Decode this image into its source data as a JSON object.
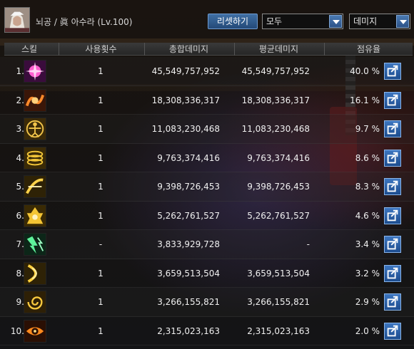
{
  "character": {
    "name": "뇌공 / 眞 아수라 (Lv.100)"
  },
  "toolbar": {
    "reset_label": "리셋하기",
    "filter_value": "모두",
    "sort_value": "데미지"
  },
  "table": {
    "headers": {
      "skill": "스킬",
      "uses": "사용횟수",
      "total": "총합데미지",
      "avg": "평균데미지",
      "share": "점유율"
    },
    "rows": [
      {
        "rank": "1.",
        "uses": "1",
        "total": "45,549,757,952",
        "avg": "45,549,757,952",
        "share": "40.0 %",
        "icon": "pink-burst-icon"
      },
      {
        "rank": "2.",
        "uses": "1",
        "total": "18,308,336,317",
        "avg": "18,308,336,317",
        "share": "16.1 %",
        "icon": "orange-wave-icon"
      },
      {
        "rank": "3.",
        "uses": "1",
        "total": "11,083,230,468",
        "avg": "11,083,230,468",
        "share": "9.7 %",
        "icon": "vitruvian-icon"
      },
      {
        "rank": "4.",
        "uses": "1",
        "total": "9,763,374,416",
        "avg": "9,763,374,416",
        "share": "8.6 %",
        "icon": "golden-rings-icon"
      },
      {
        "rank": "5.",
        "uses": "1",
        "total": "9,398,726,453",
        "avg": "9,398,726,453",
        "share": "8.3 %",
        "icon": "golden-slash-icon"
      },
      {
        "rank": "6.",
        "uses": "1",
        "total": "5,262,761,527",
        "avg": "5,262,761,527",
        "share": "4.6 %",
        "icon": "golden-crest-icon"
      },
      {
        "rank": "7.",
        "uses": "-",
        "total": "3,833,929,728",
        "avg": "-",
        "share": "3.4 %",
        "icon": "green-lightning-icon"
      },
      {
        "rank": "8.",
        "uses": "1",
        "total": "3,659,513,504",
        "avg": "3,659,513,504",
        "share": "3.2 %",
        "icon": "golden-arc-icon"
      },
      {
        "rank": "9.",
        "uses": "1",
        "total": "3,266,155,821",
        "avg": "3,266,155,821",
        "share": "2.9 %",
        "icon": "golden-swirl-icon"
      },
      {
        "rank": "10.",
        "uses": "1",
        "total": "2,315,023,163",
        "avg": "2,315,023,163",
        "share": "2.0 %",
        "icon": "eye-icon"
      }
    ]
  },
  "colors": {
    "accent": "#2b5288",
    "text": "#f0f0f0"
  }
}
